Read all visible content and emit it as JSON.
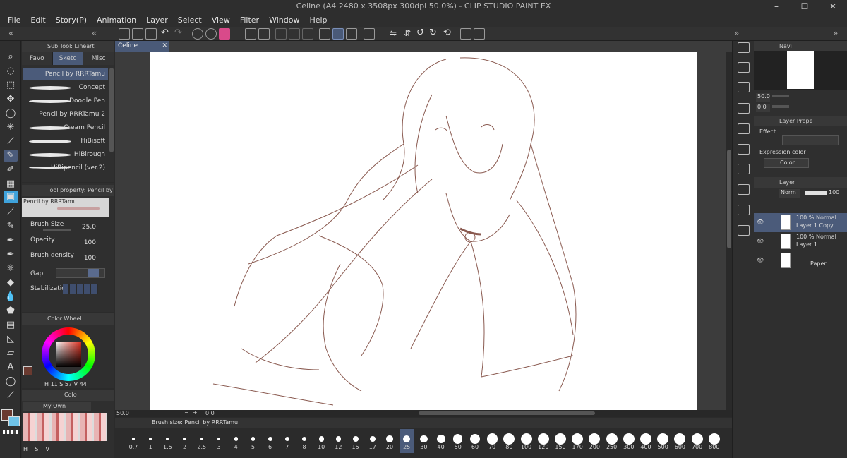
{
  "window": {
    "title": "Celine (A4 2480 x 3508px 300dpi 50.0%) - CLIP STUDIO PAINT EX",
    "min": "–",
    "max": "☐",
    "close": "✕"
  },
  "menu": [
    "File",
    "Edit",
    "Story(P)",
    "Animation",
    "Layer",
    "Select",
    "View",
    "Filter",
    "Window",
    "Help"
  ],
  "subtool": {
    "header": "Sub Tool: Lineart",
    "tabs": [
      "Favo",
      "Sketc",
      "Misc"
    ],
    "brushes": [
      "Pencil by RRRTamu",
      "Concept",
      "Doodle Pen",
      "Pencil by RRRTamu 2",
      "Cream Pencil",
      "HiBisoft",
      "HiBirough",
      "HiBipencil (ver.2)"
    ]
  },
  "toolprop": {
    "header": "Tool property: Pencil by RRR",
    "preview": "Pencil by RRRTamu",
    "brush_size_label": "Brush Size",
    "brush_size": "25.0",
    "opacity_label": "Opacity",
    "opacity": "100",
    "density_label": "Brush density",
    "density": "100",
    "gap_label": "Gap",
    "stab_label": "Stabilization"
  },
  "colorwheel": {
    "header": "Color Wheel",
    "h_label": "H",
    "h": "11",
    "s_label": "S",
    "s": "57",
    "v_label": "V",
    "v": "44",
    "main_color": "#6a3a30"
  },
  "colorset": {
    "header": "Colo",
    "set_name": "My Own",
    "h": "H",
    "s": "S",
    "v": "V"
  },
  "canvas": {
    "tab": "Celine",
    "zoom": "50.0",
    "angle": "0.0"
  },
  "brushsize": {
    "header": "Brush size: Pencil by RRRTamu",
    "selected": "25",
    "sizes": [
      "0.7",
      "1",
      "1.5",
      "2",
      "2.5",
      "3",
      "4",
      "5",
      "6",
      "7",
      "8",
      "10",
      "12",
      "15",
      "17",
      "20",
      "25",
      "30",
      "40",
      "50",
      "60",
      "70",
      "80",
      "100",
      "120",
      "150",
      "170",
      "200",
      "250",
      "300",
      "400",
      "500",
      "600",
      "700",
      "800"
    ]
  },
  "navigator": {
    "header": "Navi",
    "zoom": "50.0",
    "angle": "0.0"
  },
  "layerprop": {
    "header": "Layer Prope",
    "effect": "Effect",
    "expr_label": "Expression color",
    "expr_value": "Color"
  },
  "layers": {
    "header": "Layer",
    "blend": "Norm",
    "opacity": "100",
    "items": [
      {
        "pct": "100 % Normal",
        "name": "Layer 1 Copy"
      },
      {
        "pct": "100 % Normal",
        "name": "Layer 1"
      },
      {
        "pct": "",
        "name": "Paper"
      }
    ]
  }
}
